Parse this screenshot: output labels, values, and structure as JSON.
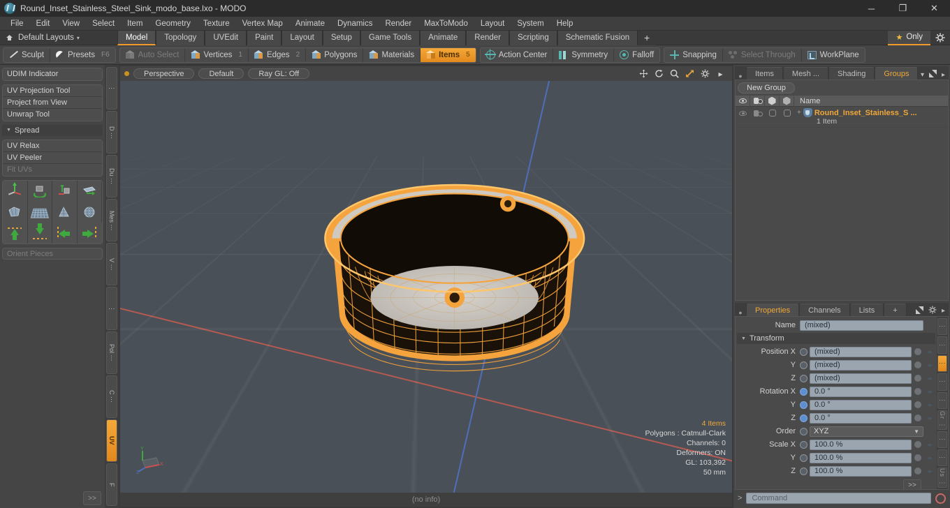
{
  "window": {
    "title": "Round_Inset_Stainless_Steel_Sink_modo_base.lxo - MODO",
    "minimize": "─",
    "maximize": "❐",
    "close": "✕"
  },
  "menu": [
    "File",
    "Edit",
    "View",
    "Select",
    "Item",
    "Geometry",
    "Texture",
    "Vertex Map",
    "Animate",
    "Dynamics",
    "Render",
    "MaxToModo",
    "Layout",
    "System",
    "Help"
  ],
  "layoutbar": {
    "home_icon": "home-icon",
    "label": "Default Layouts",
    "caret": "▾",
    "tabs": [
      {
        "label": "Model",
        "active": true
      },
      {
        "label": "Topology",
        "active": false
      },
      {
        "label": "UVEdit",
        "active": false
      },
      {
        "label": "Paint",
        "active": false
      },
      {
        "label": "Layout",
        "active": false
      },
      {
        "label": "Setup",
        "active": false
      },
      {
        "label": "Game Tools",
        "active": false
      },
      {
        "label": "Animate",
        "active": false
      },
      {
        "label": "Render",
        "active": false
      },
      {
        "label": "Scripting",
        "active": false
      },
      {
        "label": "Schematic Fusion",
        "active": false
      }
    ],
    "plus": "+",
    "only_label": "Only",
    "star": "★",
    "gear": "⚙"
  },
  "modebar": {
    "group1": [
      {
        "label": "Sculpt",
        "shortcut": "",
        "icon": "sculpt-icon",
        "state": "normal"
      },
      {
        "label": "Presets",
        "shortcut": "F6",
        "icon": "presets-icon",
        "state": "normal"
      }
    ],
    "group2": [
      {
        "label": "Auto Select",
        "shortcut": "",
        "icon": "cube-icon",
        "state": "dim"
      },
      {
        "label": "Vertices",
        "shortcut": "1",
        "icon": "cube-icon",
        "state": "normal"
      },
      {
        "label": "Edges",
        "shortcut": "2",
        "icon": "cube-icon",
        "state": "normal"
      },
      {
        "label": "Polygons",
        "shortcut": "",
        "icon": "cube-icon",
        "state": "normal"
      },
      {
        "label": "Materials",
        "shortcut": "",
        "icon": "cube-icon",
        "state": "normal"
      },
      {
        "label": "Items",
        "shortcut": "5",
        "icon": "cube-icon",
        "state": "active"
      }
    ],
    "group3": [
      {
        "label": "Action Center",
        "icon": "action-center-icon",
        "state": "normal"
      },
      {
        "label": "Symmetry",
        "icon": "symmetry-icon",
        "state": "normal"
      },
      {
        "label": "Falloff",
        "icon": "falloff-icon",
        "state": "normal"
      }
    ],
    "group4": [
      {
        "label": "Snapping",
        "icon": "snapping-icon",
        "state": "normal"
      },
      {
        "label": "Select Through",
        "icon": "select-through-icon",
        "state": "dim"
      },
      {
        "label": "WorkPlane",
        "icon": "workplane-icon",
        "state": "normal"
      }
    ]
  },
  "leftpanel": {
    "udim": "UDIM Indicator",
    "tools": [
      "UV Projection Tool",
      "Project from View",
      "Unwrap Tool"
    ],
    "spread_header": "Spread",
    "spread_tools": [
      {
        "label": "UV Relax",
        "disabled": false
      },
      {
        "label": "UV Peeler",
        "disabled": false
      },
      {
        "label": "Fit UVs",
        "disabled": true
      }
    ],
    "icon_row1": [
      "move-gizmo-icon",
      "rotate-gizmo-icon",
      "drop-gizmo-icon",
      "flip-plane-icon"
    ],
    "icon_row2": [
      "mesh-fold-icon",
      "mesh-grid-icon",
      "mesh-cone-icon",
      "mesh-sphere-icon"
    ],
    "icon_row3": [
      "align-top-icon",
      "align-bottom-icon",
      "align-left-icon",
      "align-right-icon"
    ],
    "orient_placeholder": "Orient Pieces",
    "expand": ">>",
    "vtabs": [
      "⋮",
      "D ⋯",
      "Du ⋯",
      "Mes ⋯",
      "V ⋯",
      "⋮",
      "Pol ⋯",
      "C ⋯",
      "UV",
      "F"
    ],
    "vtab_active": "UV"
  },
  "viewport": {
    "dot": "viewport-indicator",
    "pills": [
      "Perspective",
      "Default",
      "Ray GL: Off"
    ],
    "icons": [
      "move-view-icon",
      "rotate-view-icon",
      "zoom-view-icon",
      "fit-view-icon",
      "viewport-settings-icon",
      "viewport-menu-icon"
    ],
    "stats": {
      "items": "4 Items",
      "polygons": "Polygons : Catmull-Clark",
      "channels": "Channels: 0",
      "deformers": "Deformers: ON",
      "gl": "GL: 103,392",
      "scale": "50 mm"
    },
    "axis": {
      "x": "X",
      "y": "Y",
      "z": "Z"
    },
    "footer": "(no info)"
  },
  "rightpanel": {
    "tabs": [
      {
        "label": "Items",
        "active": false
      },
      {
        "label": "Mesh ...",
        "active": false
      },
      {
        "label": "Shading",
        "active": false
      },
      {
        "label": "Groups",
        "active": true
      }
    ],
    "tab_caret": "▾",
    "expand_icon": "expand-icon",
    "arrow_icon": "▸",
    "new_group": "New Group",
    "columns": [
      "eye-icon",
      "render-icon",
      "hex-icon",
      "ring-icon"
    ],
    "name_header": "Name",
    "rows": [
      {
        "plus": "+",
        "name": "Round_Inset_Stainless_S ...",
        "sub": "1 Item"
      }
    ]
  },
  "properties": {
    "tabs": [
      {
        "label": "Properties",
        "active": true
      },
      {
        "label": "Channels",
        "active": false
      },
      {
        "label": "Lists",
        "active": false
      }
    ],
    "plus": "+",
    "name_label": "Name",
    "name_value": "(mixed)",
    "transform_section": "Transform",
    "fields": [
      {
        "label": "Position X",
        "value": "(mixed)",
        "radio": "empty"
      },
      {
        "label": "Y",
        "value": "(mixed)",
        "radio": "empty"
      },
      {
        "label": "Z",
        "value": "(mixed)",
        "radio": "empty"
      },
      {
        "label": "Rotation X",
        "value": "0.0 °",
        "radio": "blue"
      },
      {
        "label": "Y",
        "value": "0.0 °",
        "radio": "blue"
      },
      {
        "label": "Z",
        "value": "0.0 °",
        "radio": "blue"
      }
    ],
    "order_label": "Order",
    "order_value": "XYZ",
    "scale_fields": [
      {
        "label": "Scale X",
        "value": "100.0 %",
        "radio": "empty"
      },
      {
        "label": "Y",
        "value": "100.0 %",
        "radio": "empty"
      },
      {
        "label": "Z",
        "value": "100.0 %",
        "radio": "empty"
      }
    ],
    "side_tabs": [
      "⋮",
      "⋮",
      "⋮",
      "⋮",
      "⋮",
      "Gr ⋮",
      "⋮",
      "⋮",
      "Us ⋮"
    ],
    "side_active_index": 2,
    "expand": ">>"
  },
  "commandbar": {
    "prompt": ">",
    "placeholder": "Command",
    "record_icon": "record-icon"
  },
  "colors": {
    "accent": "#f0a83a",
    "selection": "#f5a33c",
    "teal": "#58b6b0",
    "axis_x": "#b55a52",
    "axis_z": "#4d6fb8"
  }
}
